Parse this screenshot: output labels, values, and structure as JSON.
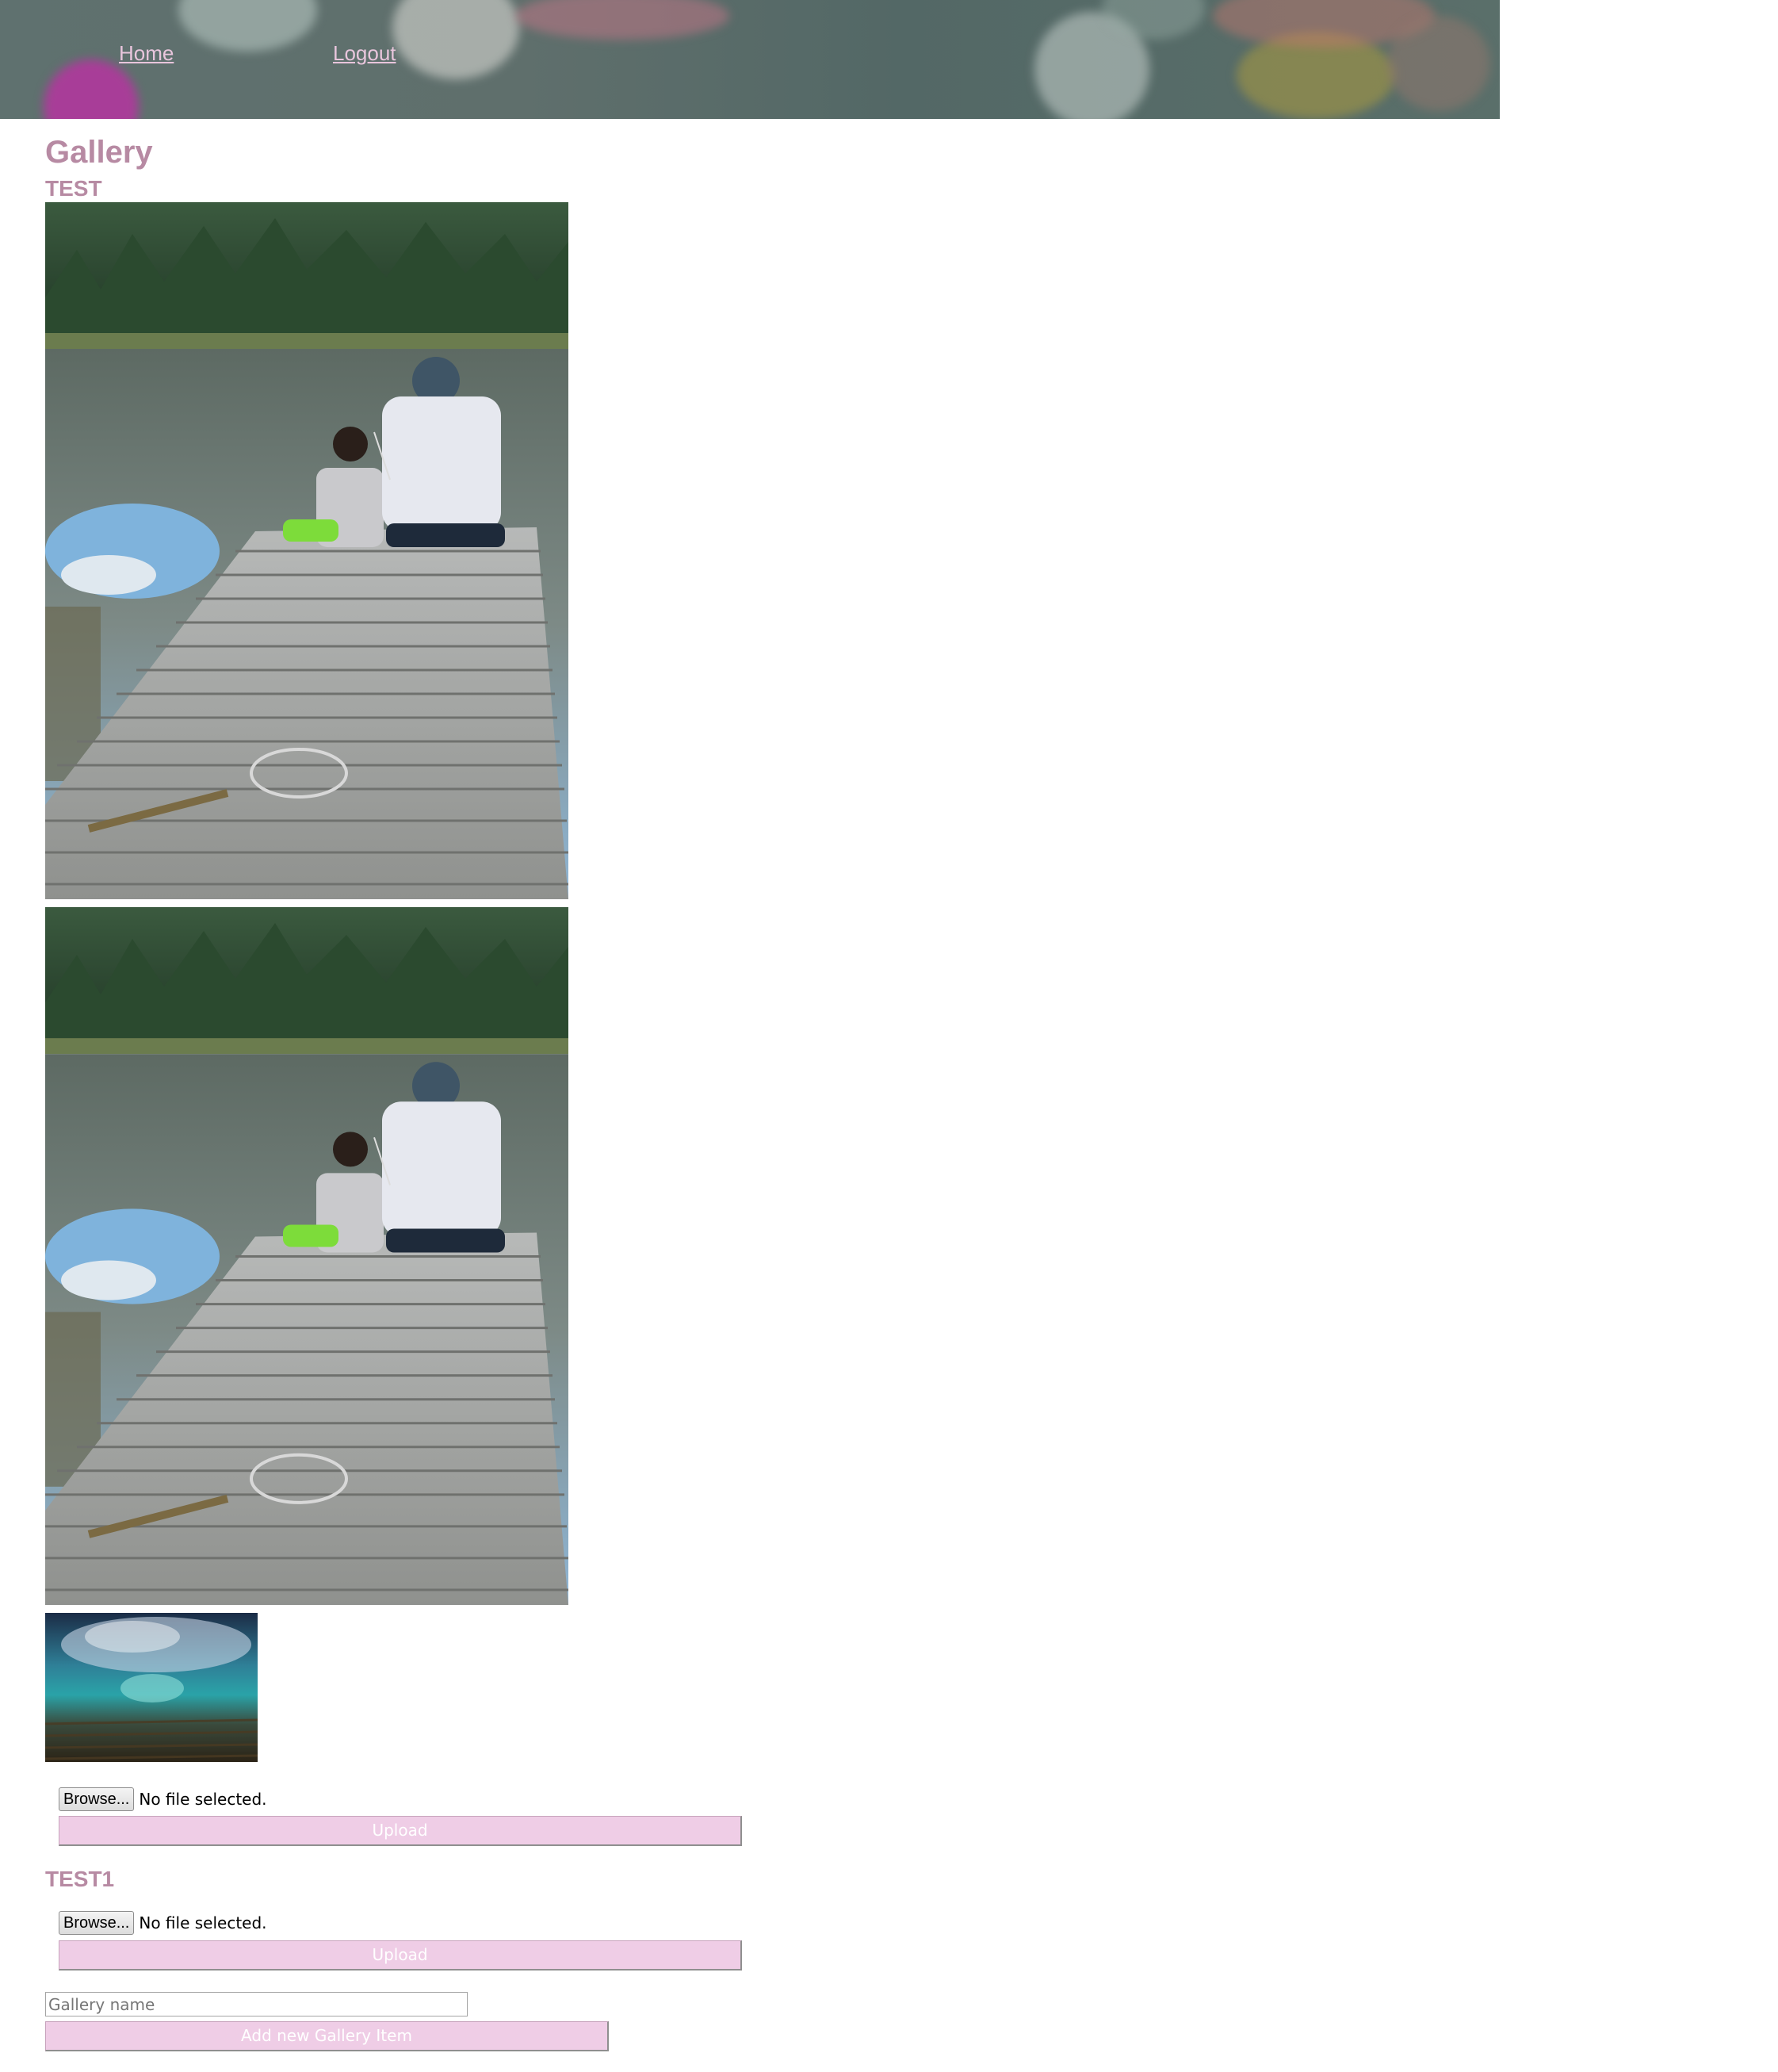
{
  "nav": {
    "home_label": "Home",
    "logout_label": "Logout"
  },
  "page": {
    "title": "Gallery"
  },
  "galleries": [
    {
      "title": "TEST",
      "photos": [
        {
          "description": "father and child fishing on a wooden dock by a lake"
        },
        {
          "description": "father and child fishing on a wooden dock by a lake"
        },
        {
          "description": "underwater view of a breaking ocean wave"
        }
      ],
      "upload_form": {
        "browse_label": "Browse...",
        "file_status": "No file selected.",
        "upload_label": "Upload"
      }
    },
    {
      "title": "TEST1",
      "photos": [],
      "upload_form": {
        "browse_label": "Browse...",
        "file_status": "No file selected.",
        "upload_label": "Upload"
      }
    }
  ],
  "new_gallery": {
    "placeholder": "Gallery name",
    "button_label": "Add new Gallery Item"
  },
  "colors": {
    "heading": "#b78aa3",
    "nav_link": "#e8c5dc",
    "button_bg": "#efcde6",
    "button_text": "#ffffff"
  }
}
